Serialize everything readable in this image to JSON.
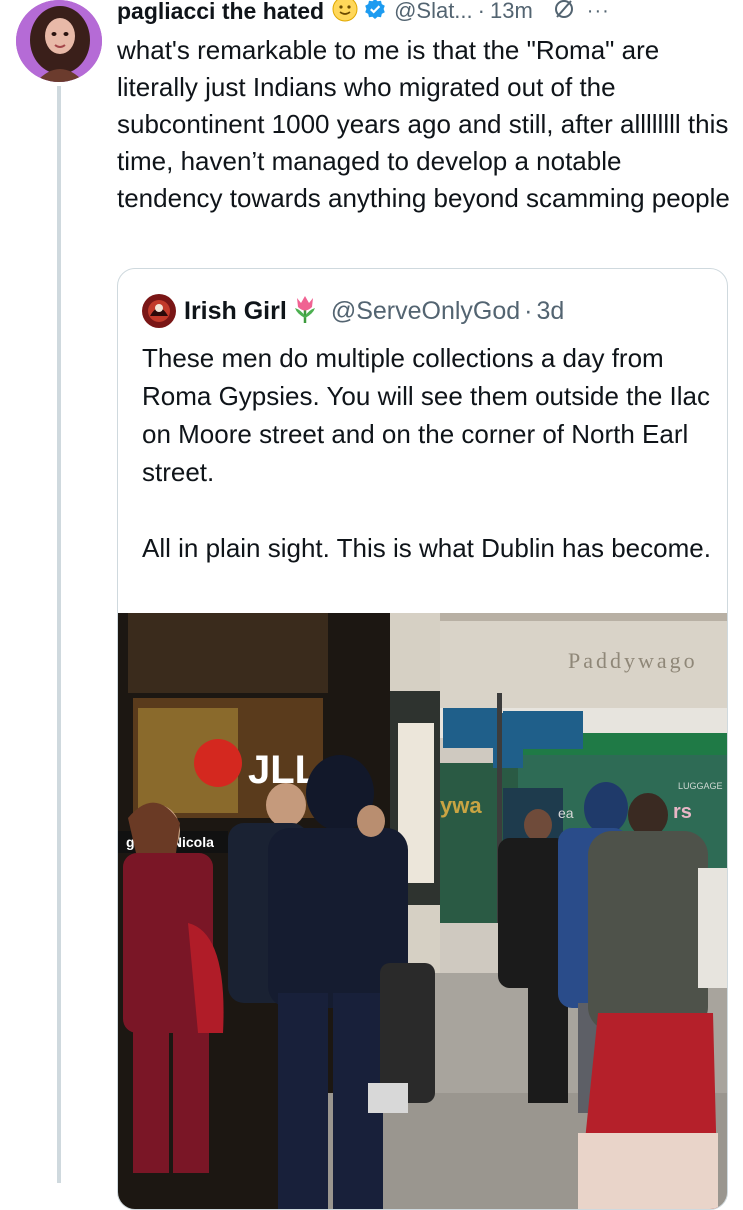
{
  "tweet": {
    "author_name": "pagliacci the hated",
    "handle": "@Slat...",
    "separator": "·",
    "time": "13m",
    "more_label": "···",
    "text": "what's remarkable to me is that the \"Roma\" are literally just Indians who migrated out of the subcontinent 1000 years ago and still, after allllllll this time, haven’t managed to develop a notable tendency towards anything beyond scamming people",
    "icons": [
      "avatar",
      "face-emoji-icon",
      "verified-badge-icon",
      "grok-icon",
      "more-icon"
    ]
  },
  "quote": {
    "author_name": "Irish Girl",
    "handle": "@ServeOnlyGod",
    "separator": "·",
    "time": "3d",
    "text": "These men do multiple collections a day from Roma Gypsies. You will see them outside the Ilac on Moore street and on the corner of North Earl street.\n\nAll in plain sight. This is what Dublin has become.",
    "icons": [
      "quote-avatar",
      "tulip-emoji-icon"
    ]
  },
  "photo": {
    "sign_paddywagon": "Paddywago",
    "sign_jll": "JLL",
    "sign_agents": "gents: Nicola",
    "sign_ywa": "ywa",
    "sign_rs": "rs",
    "sign_ea": "ea",
    "sign_luggage": "LUGGAGE"
  },
  "colors": {
    "text": "#0f1419",
    "secondary": "#536471",
    "border": "#cfd9de",
    "verified": "#1d9bf0"
  }
}
